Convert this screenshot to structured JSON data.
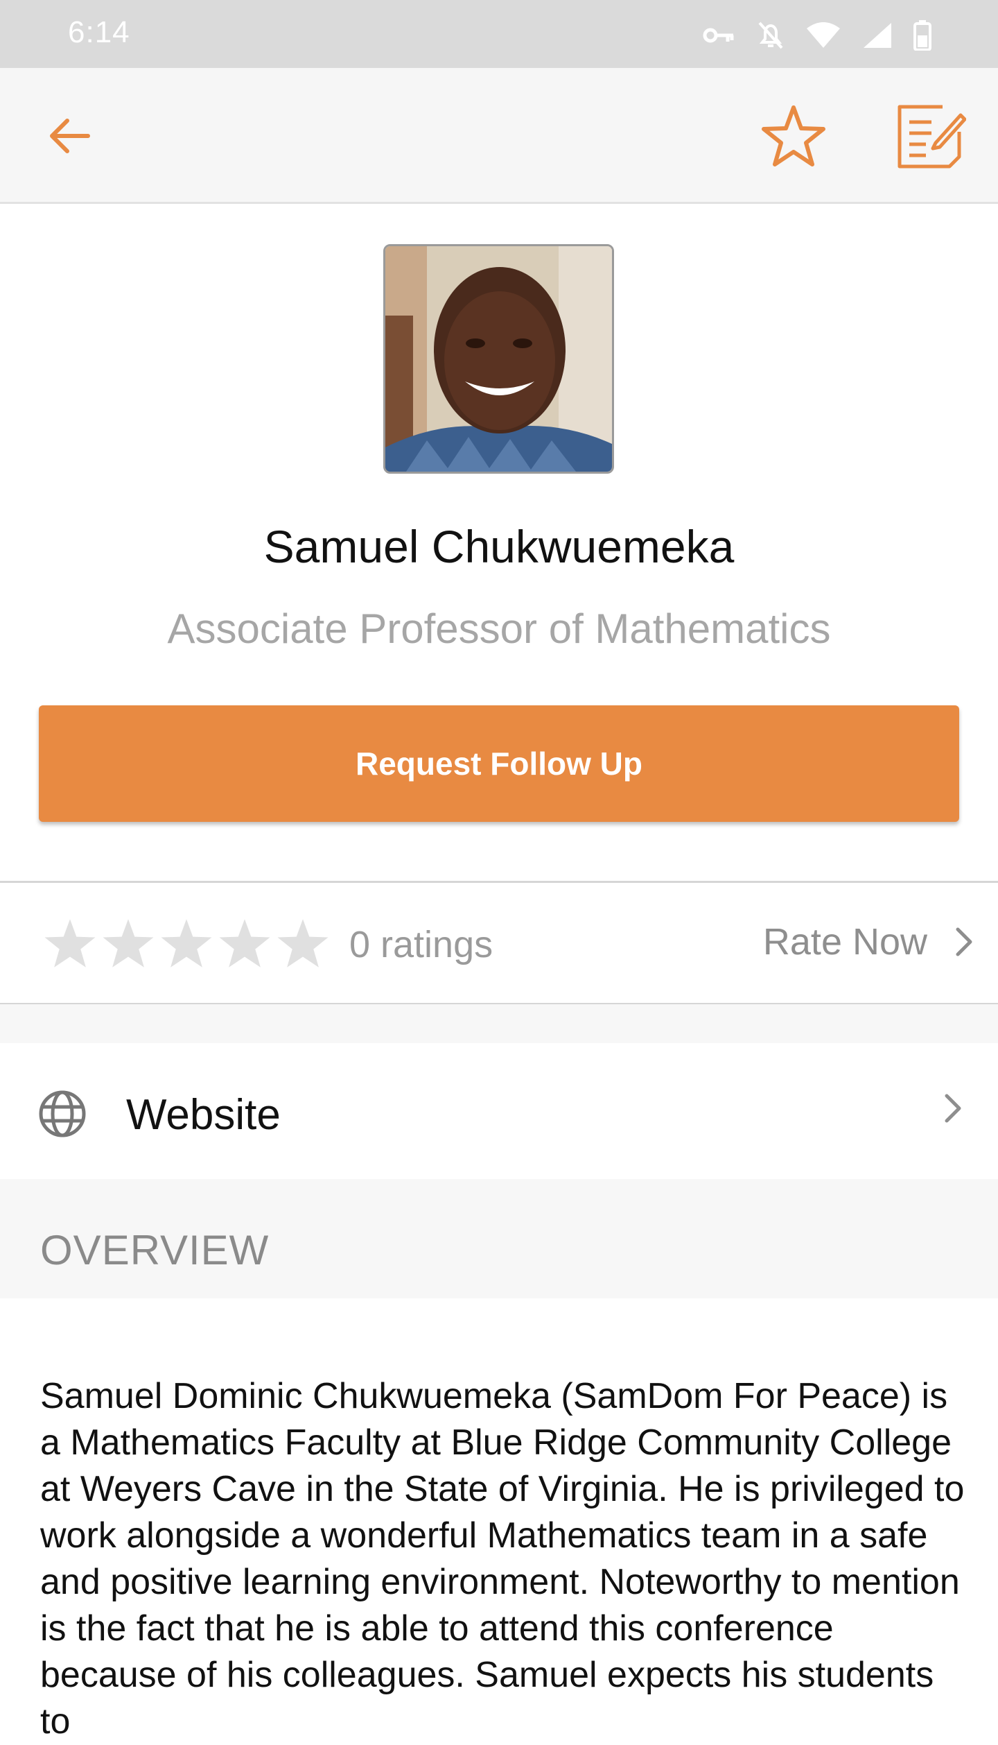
{
  "status_bar": {
    "time": "6:14",
    "icons": [
      "vpn-key-icon",
      "bell-off-icon",
      "wifi-icon",
      "signal-icon",
      "battery-icon"
    ]
  },
  "app_bar": {
    "back_icon": "arrow-left-icon",
    "favorite_icon": "star-outline-icon",
    "notes_icon": "note-edit-icon",
    "accent_color": "#e88a42"
  },
  "profile": {
    "name": "Samuel Chukwuemeka",
    "title": "Associate Professor of Mathematics"
  },
  "cta": {
    "label": "Request Follow Up",
    "color": "#e88a42"
  },
  "ratings": {
    "stars_filled": 0,
    "stars_total": 5,
    "count_label": "0 ratings",
    "rate_now_label": "Rate Now"
  },
  "links": {
    "website_label": "Website"
  },
  "overview": {
    "heading": "OVERVIEW",
    "text": "Samuel Dominic Chukwuemeka (SamDom For Peace) is a Mathematics Faculty at Blue Ridge Community College at Weyers Cave in the State of Virginia. He is privileged to work alongside a wonderful Mathematics team in a safe and positive learning environment. Noteworthy to mention is the fact that he is able to attend this conference because of his colleagues. Samuel expects his students to"
  }
}
